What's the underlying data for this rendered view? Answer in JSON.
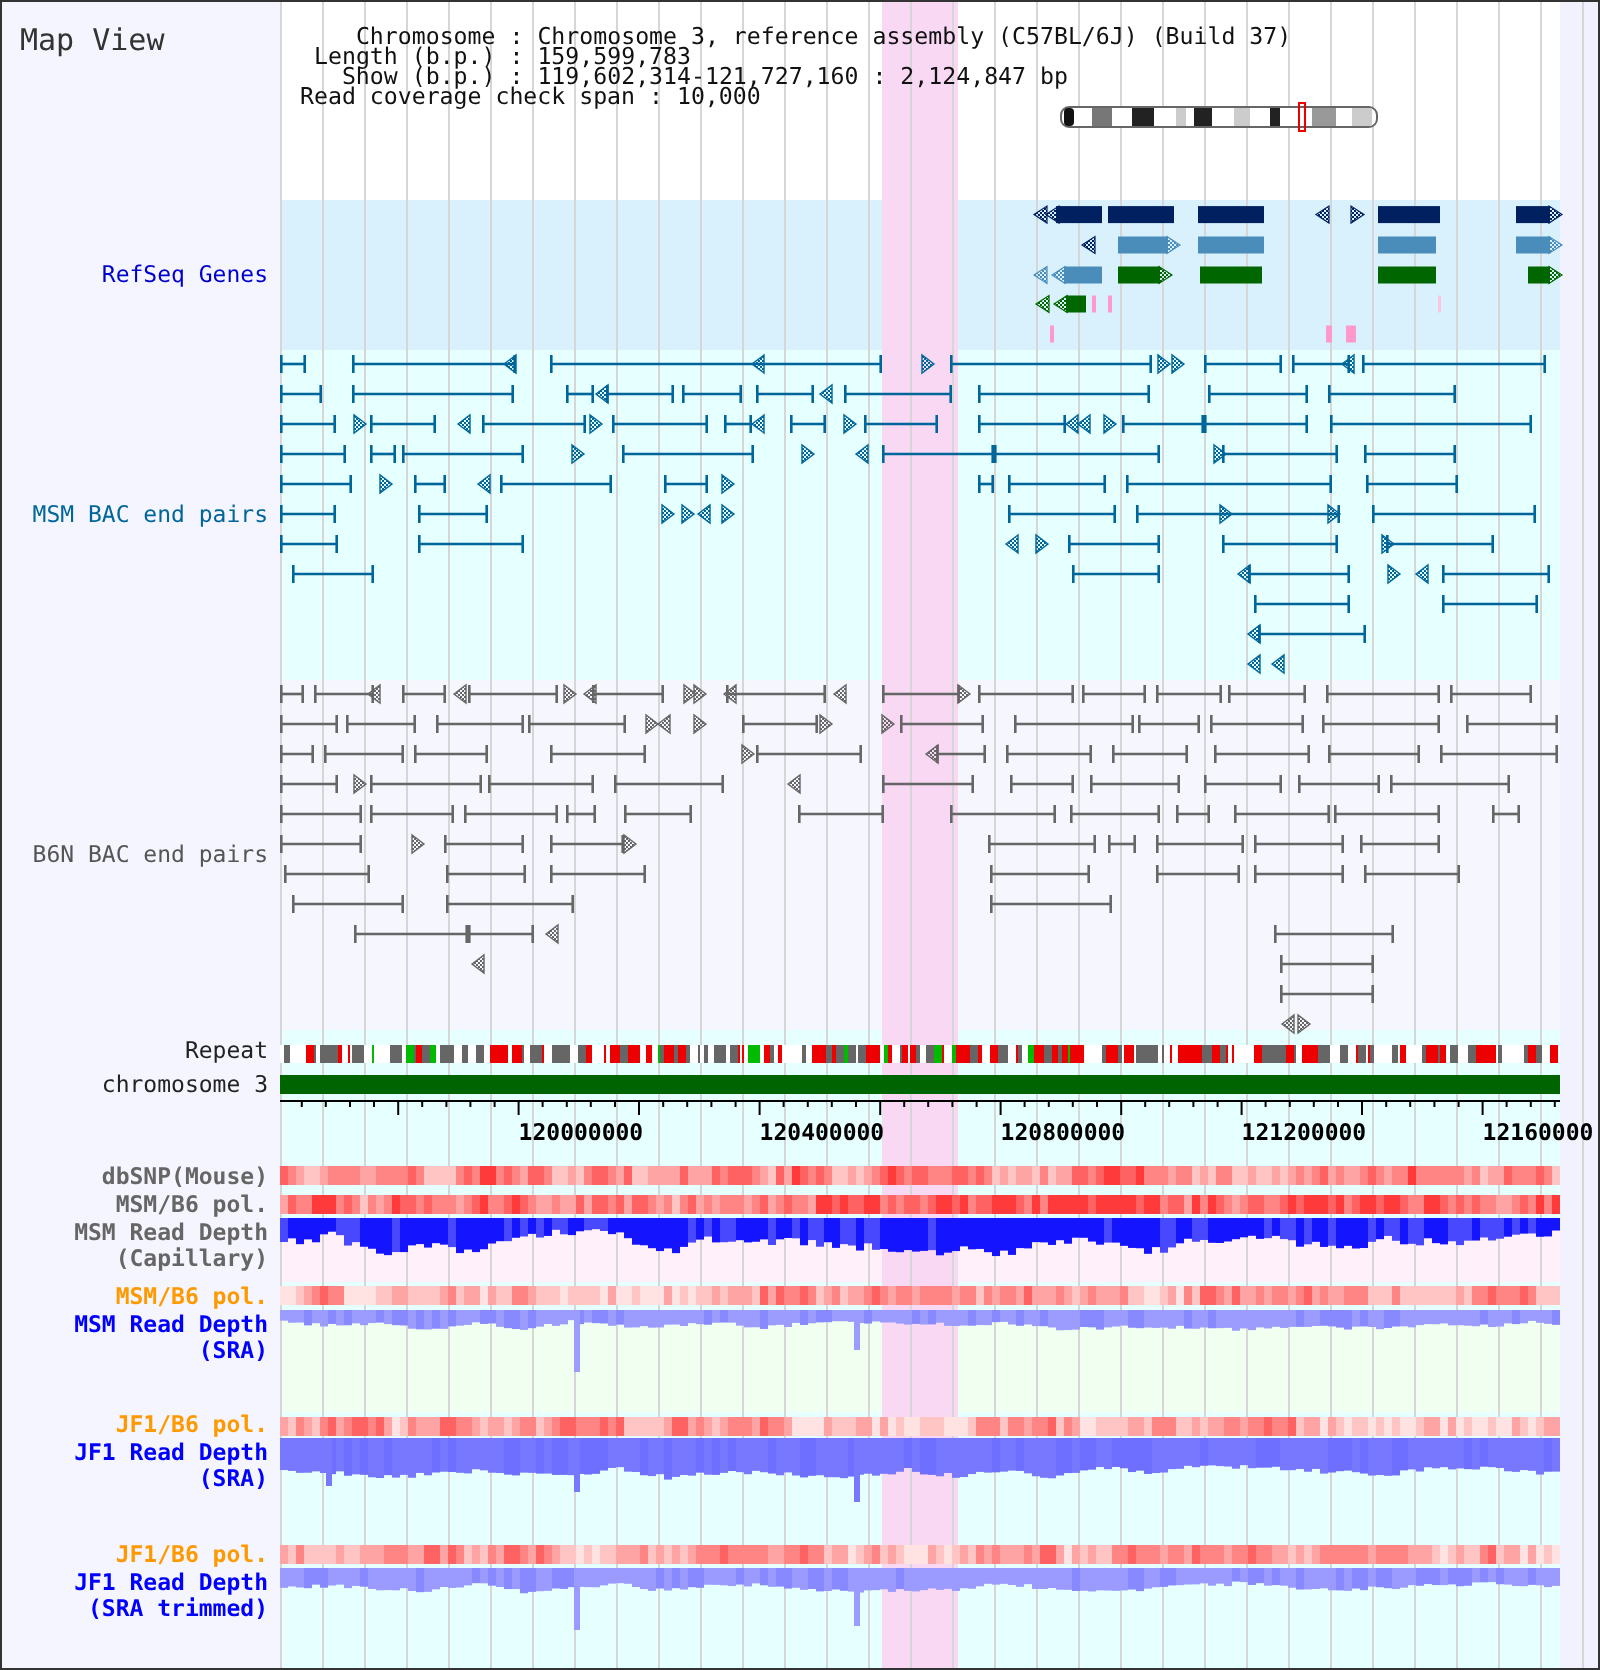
{
  "panel": {
    "title": "Map View"
  },
  "info": {
    "rows": [
      {
        "label": "Chromosome :",
        "value": "Chromosome 3, reference assembly (C57BL/6J) (Build 37)"
      },
      {
        "label": "Length (b.p.) :",
        "value": "159,599,783"
      },
      {
        "label": "Show (b.p.) :",
        "value": "119,602,314-121,727,160 : 2,124,847 bp"
      }
    ],
    "span": "Read coverage check span : 10,000"
  },
  "tracks": [
    {
      "kind": "genes",
      "label": "RefSeq Genes",
      "color": "#0000cc"
    },
    {
      "kind": "bac",
      "label": "MSM BAC end pairs",
      "color": "#006699"
    },
    {
      "kind": "bac",
      "label": "B6N BAC end pairs",
      "color": "#555555"
    },
    {
      "kind": "repeat",
      "label": "Repeat",
      "color": "#222222"
    },
    {
      "kind": "chromosome",
      "label": "chromosome 3",
      "color": "#222222"
    },
    {
      "kind": "ruler",
      "ticks": [
        "120000000",
        "120400000",
        "120800000",
        "121200000",
        "12160000"
      ]
    },
    {
      "kind": "heatmap",
      "label": "dbSNP(Mouse)",
      "color": "#666666"
    },
    {
      "kind": "heatmap",
      "label": "MSM/B6 pol.",
      "color": "#666666"
    },
    {
      "kind": "depth",
      "label": "MSM Read Depth (Capillary)",
      "color": "#666666"
    },
    {
      "kind": "heatmap",
      "label": "MSM/B6 pol.",
      "color": "#ff9900"
    },
    {
      "kind": "depth",
      "label": "MSM Read Depth (SRA)",
      "color": "#0000ff"
    },
    {
      "kind": "heatmap",
      "label": "JF1/B6 pol.",
      "color": "#ff9900"
    },
    {
      "kind": "depth",
      "label": "JF1 Read Depth (SRA)",
      "color": "#0000ff"
    },
    {
      "kind": "heatmap",
      "label": "JF1/B6 pol.",
      "color": "#ff9900"
    },
    {
      "kind": "depth",
      "label": "JF1 Read Depth (SRA trimmed)",
      "color": "#0000ff"
    }
  ]
}
